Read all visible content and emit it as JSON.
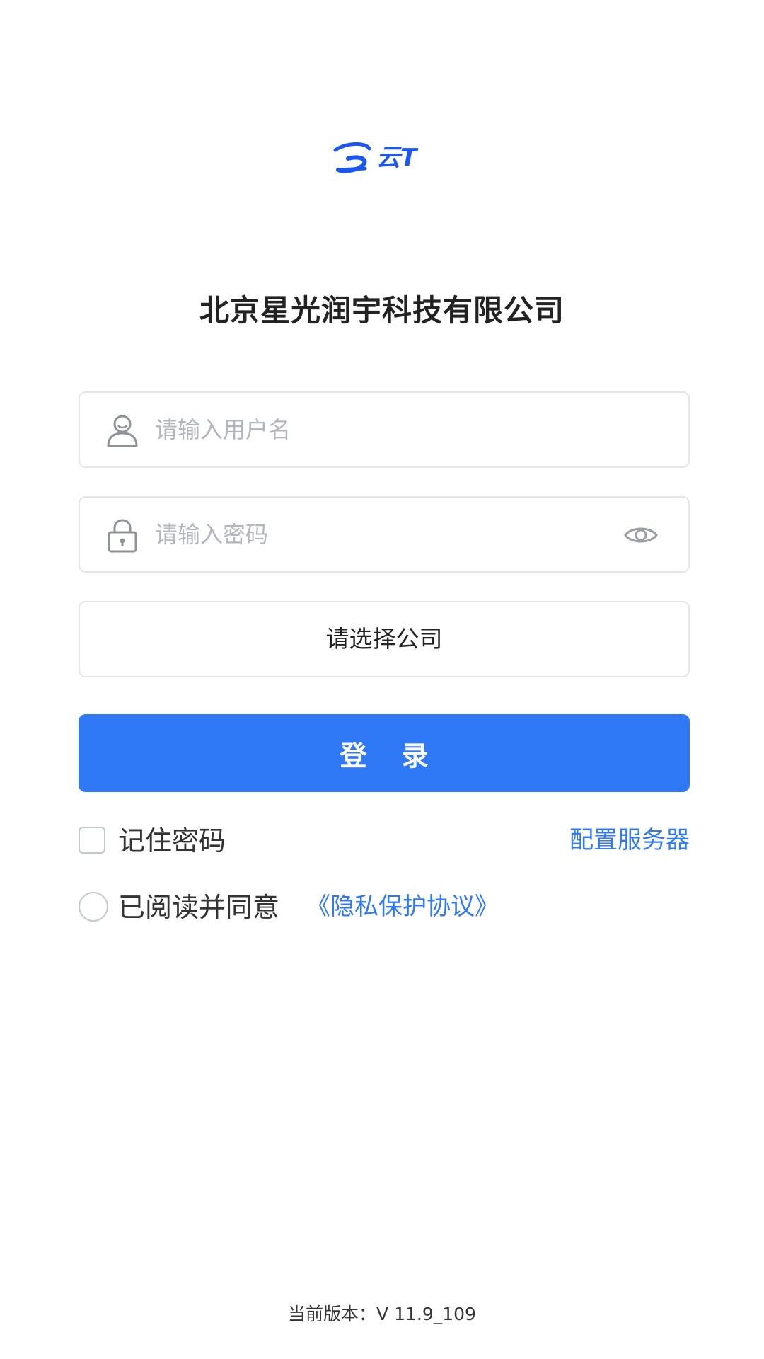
{
  "logo": {
    "text": "云T",
    "brand_color": "#1a56f0"
  },
  "company_name": "北京星光润宇科技有限公司",
  "login_form": {
    "username": {
      "placeholder": "请输入用户名",
      "value": "",
      "icon": "user-icon"
    },
    "password": {
      "placeholder": "请输入密码",
      "value": "",
      "icon": "lock-icon",
      "toggle_icon": "eye-icon"
    },
    "company_select": {
      "label": "请选择公司"
    },
    "login_button": {
      "label": "登 录",
      "color": "#2f78f6"
    }
  },
  "options": {
    "remember_password": {
      "label": "记住密码",
      "checked": false
    },
    "config_server": {
      "label": "配置服务器"
    },
    "agreement": {
      "label": "已阅读并同意",
      "link_label": "《隐私保护协议》",
      "checked": false
    }
  },
  "footer": {
    "version": "当前版本：V 11.9_109"
  },
  "colors": {
    "accent": "#2f78f6",
    "border": "#e4e6ea",
    "placeholder": "#b3b6bd",
    "icon_gray": "#8e9196"
  }
}
